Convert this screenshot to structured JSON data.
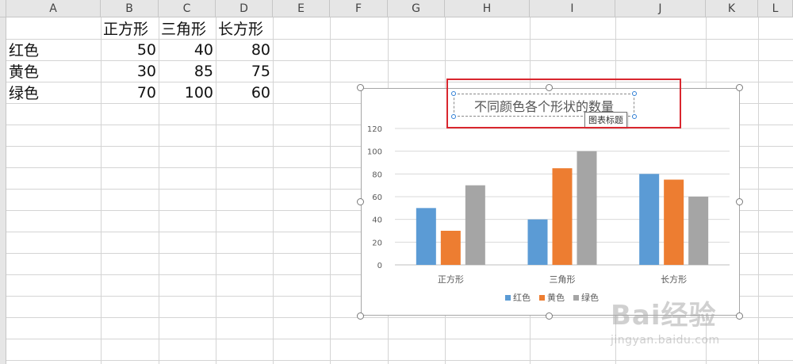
{
  "columns": [
    "A",
    "B",
    "C",
    "D",
    "E",
    "F",
    "G",
    "H",
    "I",
    "J",
    "K",
    "L"
  ],
  "table": {
    "headers": [
      "正方形",
      "三角形",
      "长方形"
    ],
    "rows": [
      {
        "label": "红色",
        "values": [
          "50",
          "40",
          "80"
        ]
      },
      {
        "label": "黄色",
        "values": [
          "30",
          "85",
          "75"
        ]
      },
      {
        "label": "绿色",
        "values": [
          "70",
          "100",
          "60"
        ]
      }
    ]
  },
  "chart_tooltip": "图表标题",
  "watermark": {
    "top": "Bai经验",
    "bottom": "jingyan.baidu.com"
  },
  "chart_data": {
    "type": "bar",
    "title": "不同颜色各个形状的数量",
    "categories": [
      "正方形",
      "三角形",
      "长方形"
    ],
    "series": [
      {
        "name": "红色",
        "values": [
          50,
          40,
          80
        ],
        "color": "#5b9bd5"
      },
      {
        "name": "黄色",
        "values": [
          30,
          85,
          75
        ],
        "color": "#ed7d31"
      },
      {
        "name": "绿色",
        "values": [
          70,
          100,
          60
        ],
        "color": "#a5a5a5"
      }
    ],
    "yticks": [
      "0",
      "20",
      "40",
      "60",
      "80",
      "100",
      "120"
    ],
    "ylim": [
      0,
      120
    ],
    "grid": true,
    "legend": "bottom"
  }
}
